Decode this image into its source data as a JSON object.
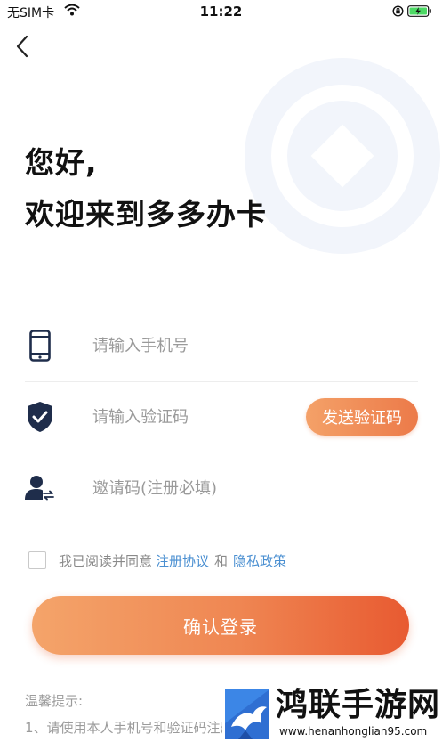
{
  "status_bar": {
    "carrier": "无SIM卡",
    "time": "11:22"
  },
  "greeting": {
    "line1": "您好,",
    "line2": "欢迎来到多多办卡"
  },
  "form": {
    "phone": {
      "placeholder": "请输入手机号",
      "value": ""
    },
    "code": {
      "placeholder": "请输入验证码",
      "value": "",
      "send_label": "发送验证码"
    },
    "invite": {
      "placeholder": "邀请码(注册必填)",
      "value": ""
    }
  },
  "agreement": {
    "checked": false,
    "prefix": "我已阅读并同意",
    "link1": "注册协议",
    "and": "和",
    "link2": "隐私政策"
  },
  "login_button": "确认登录",
  "tips": {
    "title": "温馨提示:",
    "line1": "1、请使用本人手机号和验证码注册"
  },
  "watermark": {
    "title": "鸿联手游网",
    "url": "www.henanhonglian95.com"
  },
  "colors": {
    "accent_orange": "#ec7a49",
    "link_blue": "#4a8fd1",
    "icon_navy": "#1f2d4b"
  }
}
